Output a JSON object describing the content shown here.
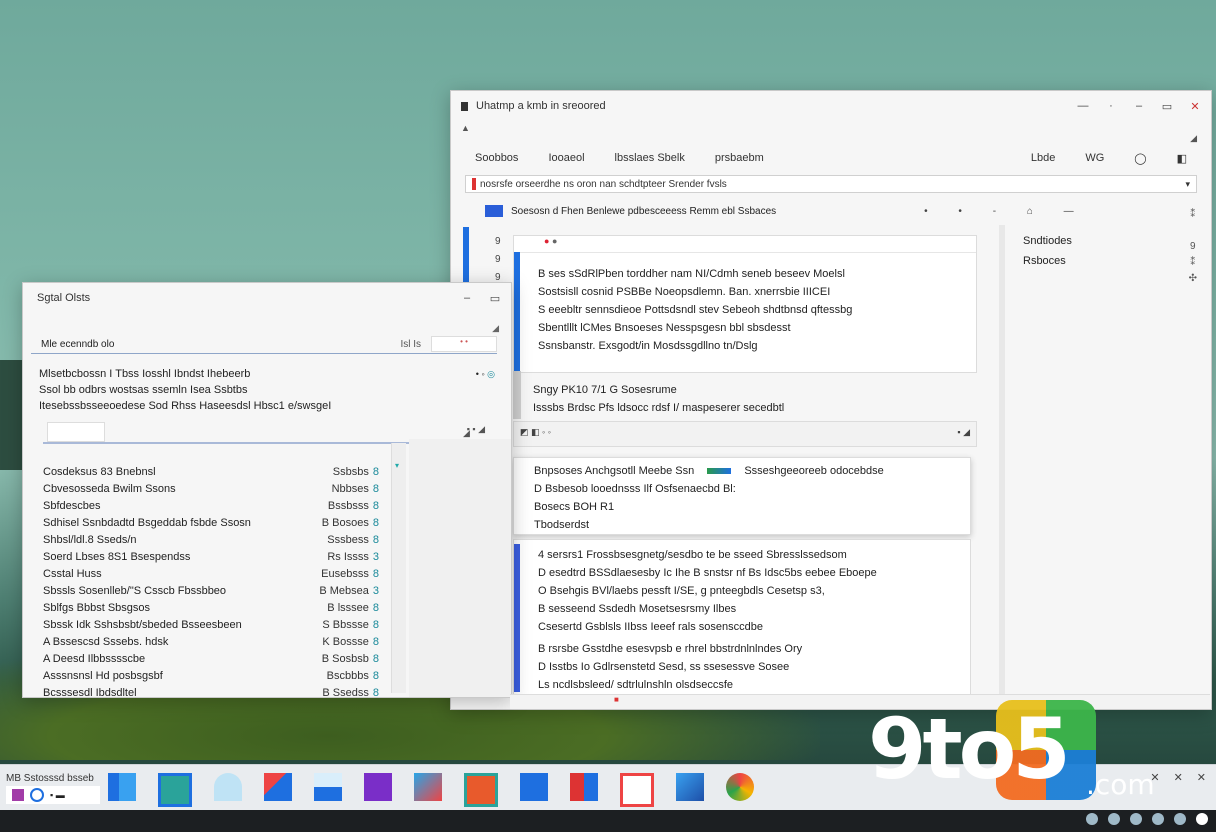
{
  "back_window": {
    "title": "Uhatmp a kmb in sreoored",
    "menu": [
      "Soobbos",
      "Iooaeol",
      "lbsslaes Sbelk",
      "prsbaebm"
    ],
    "menu_right": [
      "Lbde",
      "WG"
    ],
    "address": "nosrsfe orseerdhe ns oron nan schdtpteer Srender fvsls",
    "toolbar_text": "Soesosn d Fhen Benlewe pdbesceeess Remm ebl Ssbaces",
    "side_items": [
      "Sndtiodes",
      "Rsboces"
    ],
    "text_lines": [
      "B ses sSdRlPben torddher nam NI/Cdmh seneb beseev Moelsl",
      "Sostsisll cosnid PSBBe Noeopsdlemn. Ban. xnerrsbie IIICEI",
      "S eeebltr sennsdieoe Pottsdsndl stev Sebeoh shdtbnsd qftessbg",
      "Sbentlllt lCMes Bnsoeses Nesspsgesn bbl sbsdesst",
      "Ssnsbanstr. Exsgodt/in Mosdssgdllno tn/Dslg"
    ],
    "mid_lines": [
      "Sngy PK10 7/1 G Sosesrume",
      "Isssbs Brdsc Pfs ldsocc rdsf I/ maspeserer secedbtl"
    ],
    "popup_lines": [
      "Bnpsoses Anchgsotll Meebe Ssn",
      "Ssseshgeeoreeb odocebdse",
      "D Bsbesob looednsss Ilf Osfsenaecbd Bl:",
      "Bosecs BOH R1",
      "Tbodserdst"
    ],
    "lower_lines": [
      "4 sersrs1 Frossbsesgnetg/sesdbo te be sseed Sbresslssedsom",
      "D esedtrd BSSdlaesesby Ic Ihe B snstsr nf Bs Idsc5bs eebee Eboepe",
      "O Bsehgis BVl/laebs pessft I/SE, g pnteegbdls Cesetsp s3,",
      "B sesseend Ssdedh Mosetsesrsmy Ilbes",
      "Csesertd Gsblsls IIbss Ieeef rals sosensccdbe",
      "B rsrsbe Gsstdhe esesvpsb e rhrel bbstrdnlnlndes Ory",
      "D Isstbs Io Gdlrsenstetd Sesd, ss ssesessve Sosee",
      "Ls ncdlsbsleed/ sdtrlulnshln olsdseccsfe"
    ]
  },
  "front_window": {
    "title": "Sgtal Olsts",
    "search_label": "Mle ecenndb olo",
    "search_meta": "Isl  Is",
    "head_lines": [
      "Mlsetbcbossn I Tbss Iosshl Ibndst Ihebeerb",
      "Ssol bb odbrs wostsas ssemln Isea Ssbtbs",
      "Itesebssbsseeoedese Sod Rhss Haseesdsl Hbsc1 e/swsgeI"
    ],
    "rows": [
      {
        "name": "Cosdeksus 83 Bnebnsl",
        "value": "Ssbsbs",
        "n": "8"
      },
      {
        "name": "Cbvesosseda Bwilm Ssons",
        "value": "Nbbses",
        "n": "8"
      },
      {
        "name": "Sbfdescbes",
        "value": "Bssbsss",
        "n": "8"
      },
      {
        "name": "Sdhisel Ssnbdadtd Bsgeddab fsbde Ssosn",
        "value": "B Bosoes",
        "n": "8"
      },
      {
        "name": "Shbsl/ldl.8 Sseds/n",
        "value": "Sssbess",
        "n": "8"
      },
      {
        "name": "Soerd Lbses 8S1 Bsespendss",
        "value": "Rs Issss",
        "n": "3"
      },
      {
        "name": "Csstal Huss",
        "value": "Eusebsss",
        "n": "8"
      },
      {
        "name": "Sbssls Sosenlleb/\"S Csscb Fbssbbeo",
        "value": "B Mebsea",
        "n": "3"
      },
      {
        "name": "Sblfgs       Bbbst Sbsgsos",
        "value": "B lsssee",
        "n": "8"
      },
      {
        "name": "Sbssk Idk  Sshsbsbt/sbeded Bsseesbeen",
        "value": "S Bbssse",
        "n": "8"
      },
      {
        "name": "A Bssescsd  Sssebs. hdsk",
        "value": "K Bossse",
        "n": "8"
      },
      {
        "name": "A Deesd Ilbbsssscbe",
        "value": "B Sosbsb",
        "n": "8"
      },
      {
        "name": "Asssnsnsl Hd posbsgsbf",
        "value": "Bscbbbs",
        "n": "8"
      },
      {
        "name": "Bcsssesdl Ibdsdltel",
        "value": "B Ssedss",
        "n": "8"
      }
    ]
  },
  "taskbar": {
    "label": "MB Sstosssd bsseb"
  },
  "logo": {
    "main": "9to5",
    "suffix": ".com"
  },
  "colors": {
    "accent_blue": "#1e6fe0",
    "wallpaper_teal": "#7fb6a8",
    "logo_green": "#3cb54a",
    "logo_blue": "#1b7fd6",
    "logo_orange": "#f26b21"
  }
}
